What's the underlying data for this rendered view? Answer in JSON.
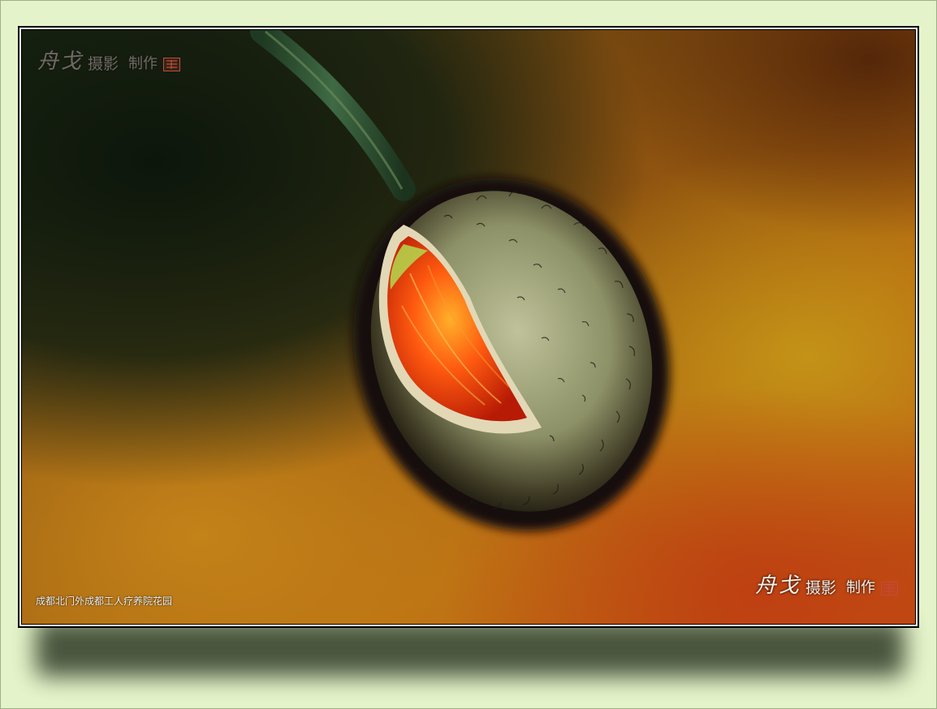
{
  "watermark": {
    "signature": "舟戈",
    "label": "摄影",
    "made": "制作"
  },
  "caption": "成都北门外成都工人疗养院花园"
}
